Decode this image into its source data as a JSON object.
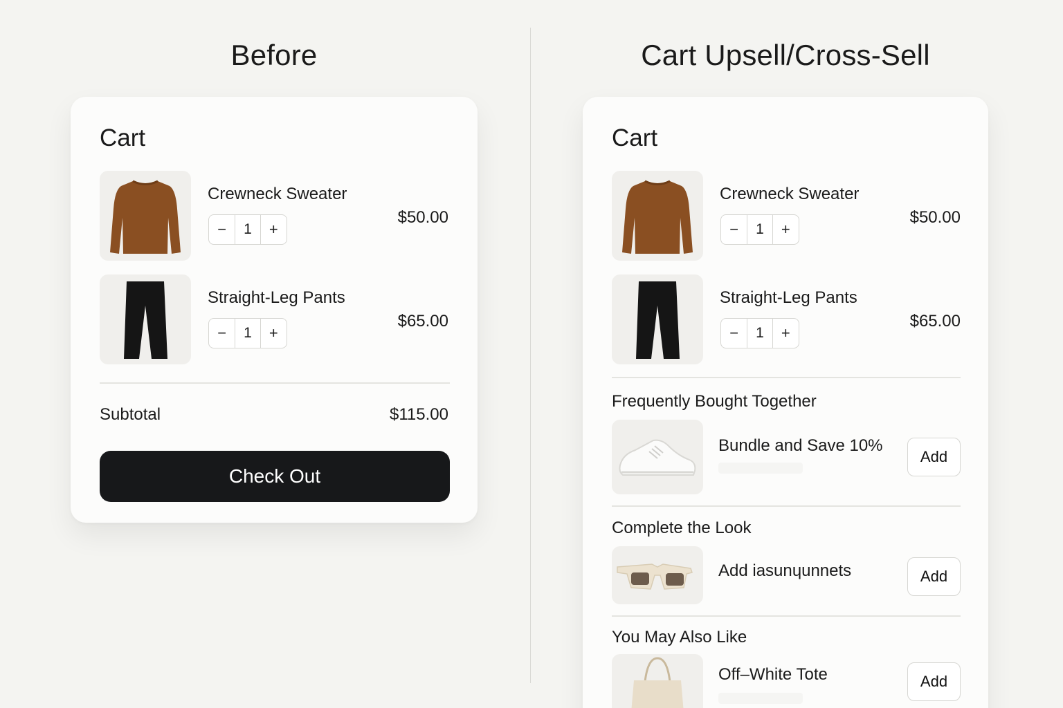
{
  "before": {
    "heading": "Before",
    "cart_title": "Cart",
    "items": [
      {
        "name": "Crewneck Sweater",
        "qty": "1",
        "price": "$50.00",
        "icon": "sweater-image"
      },
      {
        "name": "Straight-Leg Pants",
        "qty": "1",
        "price": "$65.00",
        "icon": "pants-image"
      }
    ],
    "subtotal_label": "Subtotal",
    "subtotal_value": "$115.00",
    "checkout_label": "Check Out"
  },
  "after": {
    "heading": "Cart Upsell/Cross-Sell",
    "cart_title": "Cart",
    "items": [
      {
        "name": "Crewneck Sweater",
        "qty": "1",
        "price": "$50.00",
        "icon": "sweater-image"
      },
      {
        "name": "Straight-Leg Pants",
        "qty": "1",
        "price": "$65.00",
        "icon": "pants-image"
      }
    ],
    "sections": [
      {
        "title": "Frequently Bought Together",
        "product": "Bundle and Save 10%",
        "add_label": "Add",
        "icon": "sneaker-image"
      },
      {
        "title": "Complete the Look",
        "product": "Add iasunɥunnets",
        "add_label": "Add",
        "icon": "sunglasses-image"
      },
      {
        "title": "You May Also Like",
        "product": "Off–White Tote",
        "add_label": "Add",
        "icon": "tote-bag-image"
      }
    ]
  },
  "qty_controls": {
    "minus": "−",
    "plus": "+"
  },
  "colors": {
    "checkout_bg": "#17181a",
    "page_bg": "#f4f4f1",
    "sweater": "#8a4f22",
    "pants": "#151515"
  }
}
